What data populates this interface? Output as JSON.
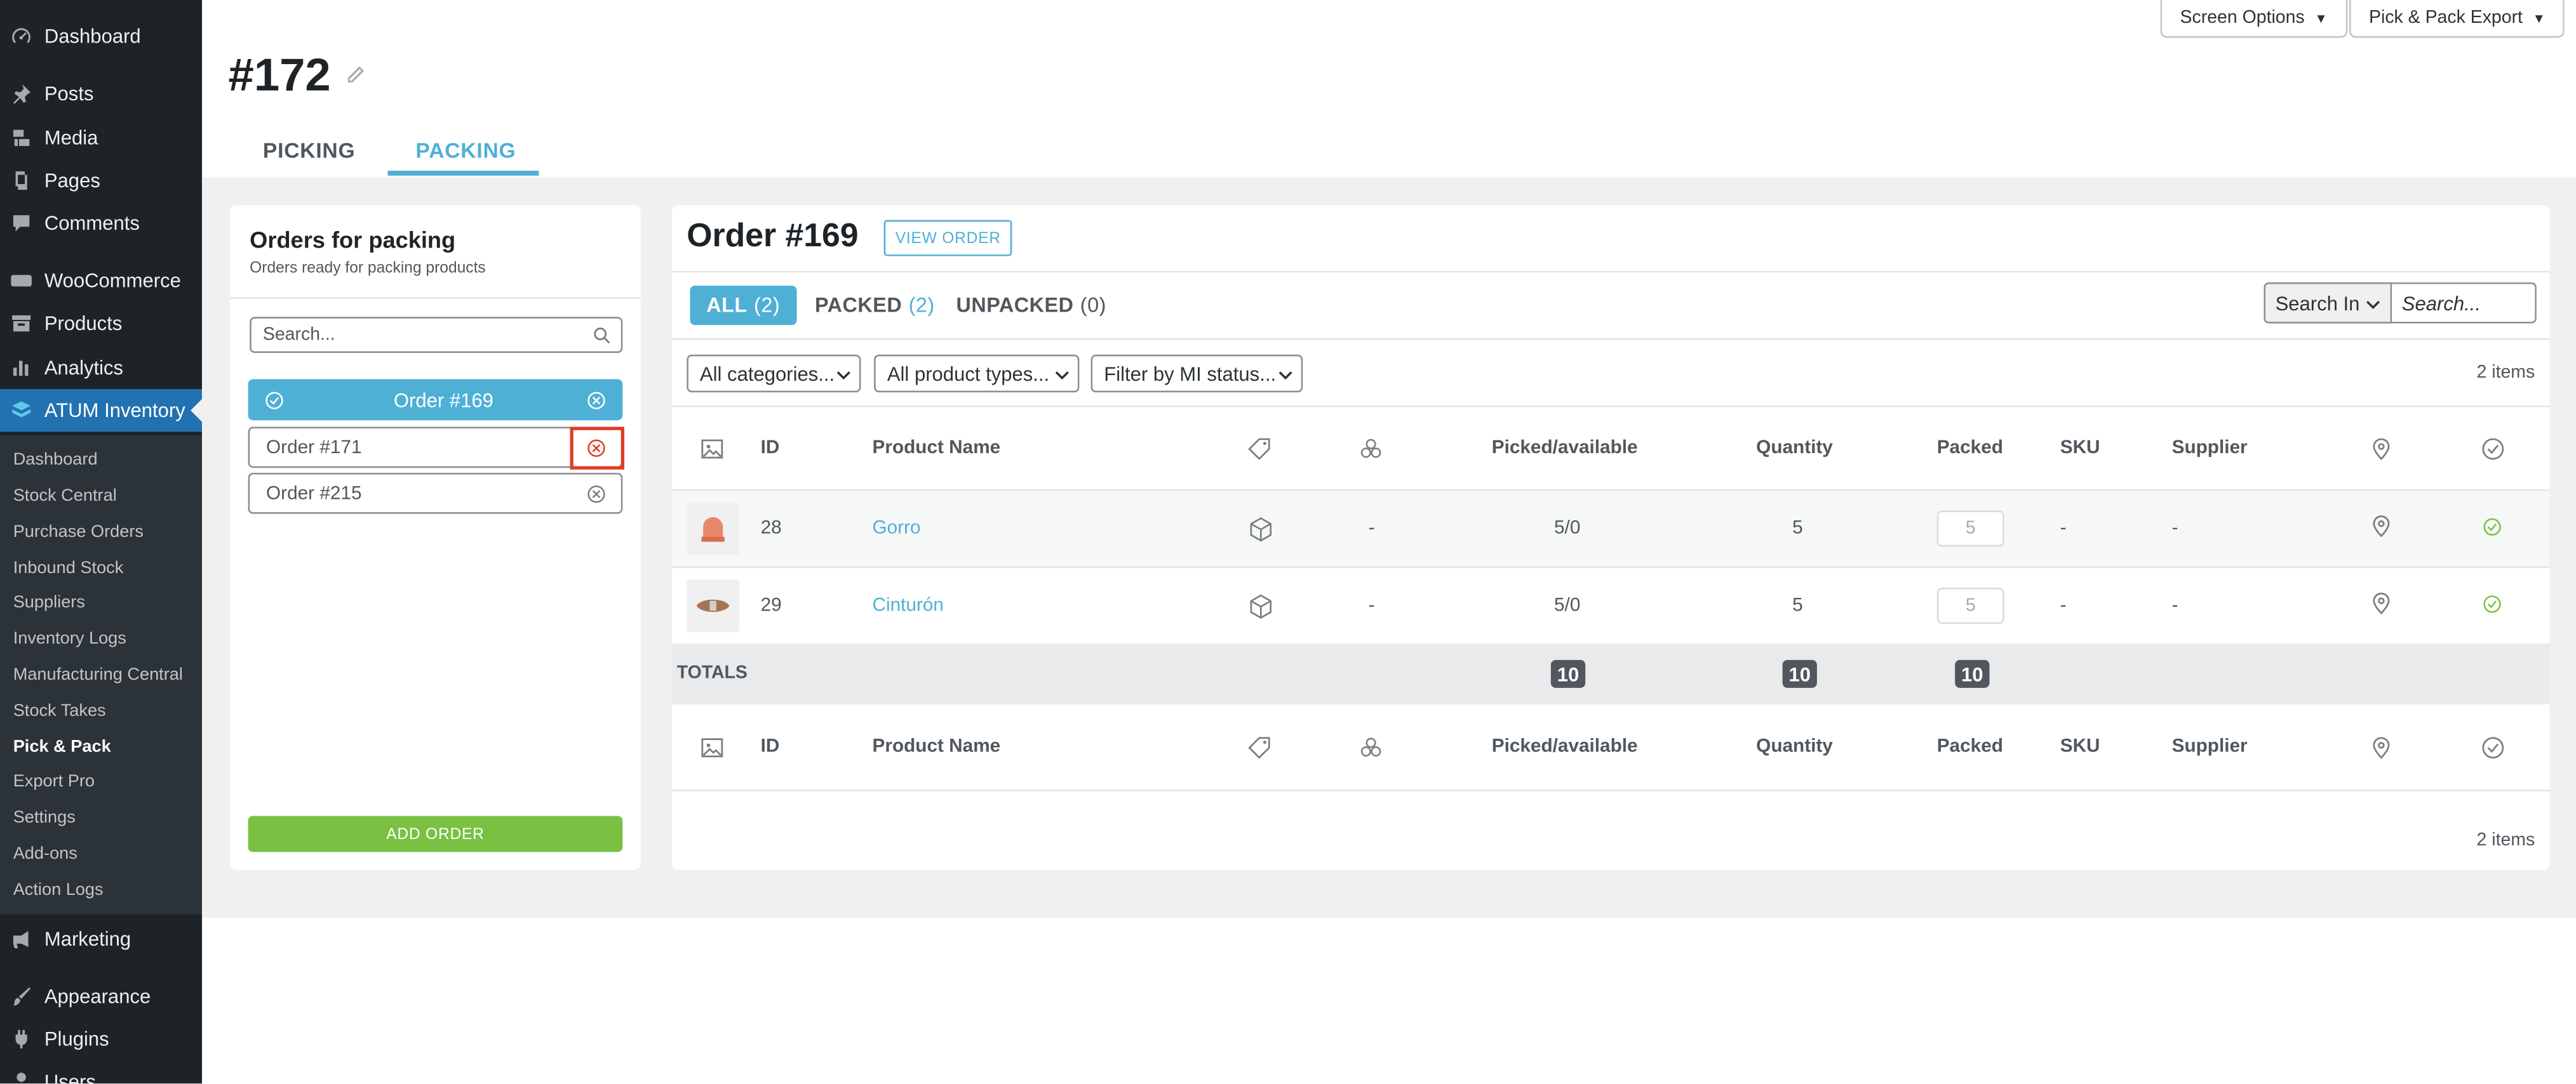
{
  "admin_menu": {
    "top": [
      {
        "label": "Dashboard",
        "icon": "dashboard-icon"
      },
      {
        "label": "Posts",
        "icon": "pin-icon"
      },
      {
        "label": "Media",
        "icon": "media-icon"
      },
      {
        "label": "Pages",
        "icon": "pages-icon"
      },
      {
        "label": "Comments",
        "icon": "comment-icon"
      },
      {
        "label": "WooCommerce",
        "icon": "woo-icon"
      },
      {
        "label": "Products",
        "icon": "archive-icon"
      },
      {
        "label": "Analytics",
        "icon": "chart-icon"
      },
      {
        "label": "ATUM Inventory",
        "icon": "atum-icon"
      }
    ],
    "submenu": [
      "Dashboard",
      "Stock Central",
      "Purchase Orders",
      "Inbound Stock",
      "Suppliers",
      "Inventory Logs",
      "Manufacturing Central",
      "Stock Takes",
      "Pick & Pack",
      "Export Pro",
      "Settings",
      "Add-ons",
      "Action Logs"
    ],
    "current_submenu": "Pick & Pack",
    "bottom": [
      {
        "label": "Marketing",
        "icon": "megaphone-icon"
      },
      {
        "label": "Appearance",
        "icon": "brush-icon"
      },
      {
        "label": "Plugins",
        "icon": "plugin-icon"
      },
      {
        "label": "Users",
        "icon": "users-icon"
      }
    ]
  },
  "header": {
    "screen_options": "Screen Options",
    "export_button": "Pick & Pack Export",
    "title": "#172",
    "tabs": [
      "PICKING",
      "PACKING"
    ],
    "active_tab": "PACKING"
  },
  "left_panel": {
    "title": "Orders for packing",
    "subtitle": "Orders ready for packing products",
    "search_placeholder": "Search...",
    "orders": [
      "Order #169",
      "Order #171",
      "Order #215"
    ],
    "selected_order": "Order #169",
    "add_button": "ADD ORDER"
  },
  "right_panel": {
    "title": "Order #169",
    "view_button": "VIEW ORDER",
    "filter_tabs": [
      {
        "label": "ALL",
        "count": "(2)"
      },
      {
        "label": "PACKED",
        "count": "(2)"
      },
      {
        "label": "UNPACKED",
        "count": "(0)"
      }
    ],
    "search_in_label": "Search In",
    "search_placeholder": "Search...",
    "filters": [
      "All categories...",
      "All product types...",
      "Filter by MI status..."
    ],
    "items_count": "2 items",
    "columns": {
      "id": "ID",
      "name": "Product Name",
      "picked": "Picked/available",
      "quantity": "Quantity",
      "packed": "Packed",
      "sku": "SKU",
      "supplier": "Supplier"
    },
    "rows": [
      {
        "id": "28",
        "name": "Gorro",
        "type_dash": "-",
        "picked": "5/0",
        "quantity": "5",
        "packed": "5",
        "sku": "-",
        "supplier": "-"
      },
      {
        "id": "29",
        "name": "Cinturón",
        "type_dash": "-",
        "picked": "5/0",
        "quantity": "5",
        "packed": "5",
        "sku": "-",
        "supplier": "-"
      }
    ],
    "totals": {
      "label": "TOTALS",
      "picked": "10",
      "quantity": "10",
      "packed": "10"
    }
  },
  "colors": {
    "accent": "#4fb0d6",
    "add_green": "#7ac143",
    "highlight": "#e03b24",
    "sidebar": "#1d2327"
  }
}
